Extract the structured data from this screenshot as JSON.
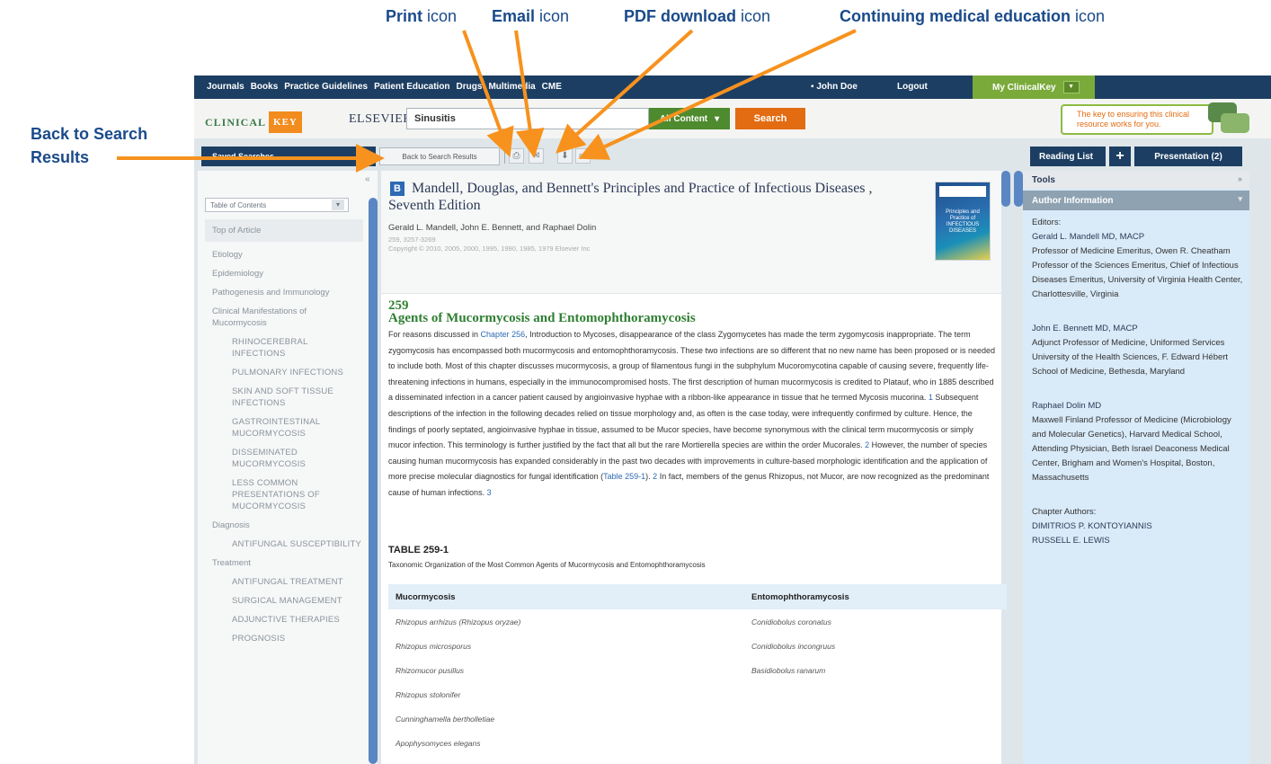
{
  "callouts": {
    "print": {
      "bold": "Print",
      "rest": " icon"
    },
    "email": {
      "bold": "Email",
      "rest": " icon"
    },
    "pdf": {
      "bold": "PDF download",
      "rest": " icon"
    },
    "cme": {
      "bold": "Continuing medical education",
      "rest": " icon"
    },
    "back_line1": "Back to Search",
    "back_line2": "Results"
  },
  "colors": {
    "callout_arrow": "#f7921e",
    "nav_bar": "#1c3e62",
    "accent_green": "#2f7f32"
  },
  "topnav": {
    "links": [
      "Journals",
      "Books",
      "Practice Guidelines",
      "Patient Education",
      "Drugs",
      "Multimedia",
      "CME"
    ],
    "user": "John Doe",
    "logout": "Logout",
    "my_clinicalkey": "My ClinicalKey"
  },
  "header": {
    "logo_left": "CLINICAL",
    "logo_key": "KEY",
    "elsevier": "ELSEVIER",
    "search_value": "Sinusitis",
    "content_dropdown": "All Content",
    "search_button": "Search",
    "tagline": "The key to ensuring this clinical resource works for you."
  },
  "toolbar": {
    "saved_searches": "Saved Searches",
    "back_to_results": "Back to Search Results",
    "icons": [
      "print-icon",
      "email-icon",
      "pdf-download-icon",
      "cme-icon"
    ],
    "reading_list": "Reading List",
    "presentation": "Presentation (2)"
  },
  "toc": {
    "collapse": "«",
    "select": "Table of Contents",
    "items": [
      {
        "label": "Top of Article",
        "level": 0
      },
      {
        "label": "Etiology",
        "level": 0
      },
      {
        "label": "Epidemiology",
        "level": 0
      },
      {
        "label": "Pathogenesis and Immunology",
        "level": 0
      },
      {
        "label": "Clinical Manifestations of Mucormycosis",
        "level": 0
      },
      {
        "label": "Rhinocerebral Infections",
        "level": 1
      },
      {
        "label": "Pulmonary Infections",
        "level": 1
      },
      {
        "label": "Skin and Soft Tissue Infections",
        "level": 1
      },
      {
        "label": "Gastrointestinal Mucormycosis",
        "level": 1
      },
      {
        "label": "Disseminated Mucormycosis",
        "level": 1
      },
      {
        "label": "Less Common Presentations of Mucormycosis",
        "level": 1
      },
      {
        "label": "Diagnosis",
        "level": 0
      },
      {
        "label": "Antifungal Susceptibility",
        "level": 1
      },
      {
        "label": "Treatment",
        "level": 0
      },
      {
        "label": "Antifungal Treatment",
        "level": 1
      },
      {
        "label": "Surgical Management",
        "level": 1
      },
      {
        "label": "Adjunctive Therapies",
        "level": 1
      },
      {
        "label": "Prognosis",
        "level": 1
      }
    ]
  },
  "article": {
    "book_badge": "B",
    "book_title": "Mandell, Douglas, and Bennett's Principles and Practice of Infectious Diseases ,",
    "edition": "Seventh Edition",
    "authors": "Gerald L. Mandell, John E. Bennett, and Raphael Dolin",
    "pages": "259, 3257-3269",
    "copyright": "Copyright © 2010, 2005, 2000, 1995, 1990, 1985, 1979 Elsevier Inc",
    "cover_text": "Principles and Practice of INFECTIOUS DISEASES",
    "chapter_number": "259",
    "chapter_title": "Agents of Mucormycosis and Entomophthoramycosis",
    "body": {
      "p1": "For reasons discussed in ",
      "link1": "Chapter 256",
      "p2": ", Introduction to Mycoses, disappearance of the class Zygomycetes has made the term zygomycosis inappropriate. The term zygomycosis has encompassed both mucormycosis and entomophthoramycosis. These two infections are so different that no new name has been proposed or is needed to include both. Most of this chapter discusses mucormycosis, a group of filamentous fungi in the subphylum Mucoromycotina capable of causing severe, frequently life-threatening infections in humans, especially in the immunocompromised hosts. The first description of human mucormycosis is credited to Platauf, who in 1885 described a disseminated infection in a cancer patient caused by angioinvasive hyphae with a ribbon-like appearance in tissue that he termed Mycosis mucorina.",
      "ref1": "1",
      "p3": " Subsequent descriptions of the infection in the following decades relied on tissue morphology and, as often is the case today, were infrequently confirmed by culture. Hence, the findings of poorly septated, angioinvasive hyphae in tissue, assumed to be Mucor species, have become synonymous with the clinical term mucormycosis or simply mucor infection. This terminology is further justified by the fact that all but the rare Mortierella species are within the order Mucorales.",
      "ref2": "2",
      "p4": " However, the number of species causing human mucormycosis has expanded considerably in the past two decades with improvements in culture-based morphologic identification and the application of more precise molecular diagnostics for fungal identification (",
      "link2": "Table 259-1",
      "p5": "). ",
      "ref3": "2",
      "p6": " In fact, members of the genus Rhizopus, not Mucor, are now recognized as the predominant cause of human infections.",
      "ref4": "3"
    },
    "table_label": "TABLE 259-1",
    "table_caption": "Taxonomic Organization of the Most Common Agents of Mucormycosis and Entomophthoramycosis",
    "table_headers": [
      "Mucormycosis",
      "Entomophthoramycosis"
    ],
    "table_rows": [
      [
        "Rhizopus arrhizus (Rhizopus oryzae)",
        "Conidiobolus coronatus"
      ],
      [
        "Rhizopus microsporus",
        "Conidiobolus incongruus"
      ],
      [
        "Rhizomucor pusillus",
        "Basidiobolus ranarum"
      ],
      [
        "Rhizopus stolonifer",
        ""
      ],
      [
        "Cunninghamella bertholletiae",
        ""
      ],
      [
        "Apophysomyces elegans",
        ""
      ]
    ]
  },
  "right": {
    "tools": "Tools",
    "tools_collapse": "»",
    "author_info": "Author Information",
    "editors_label": "Editors:",
    "editor1_name": "Gerald L. Mandell MD, MACP",
    "editor1_desc": "Professor of Medicine Emeritus, Owen R. Cheatham Professor of the Sciences Emeritus, Chief of Infectious Diseases Emeritus, University of Virginia Health Center, Charlottesville, Virginia",
    "editor2_name": "John E. Bennett MD, MACP",
    "editor2_desc": "Adjunct Professor of Medicine, Uniformed Services University of the Health Sciences, F. Edward Hébert School of Medicine, Bethesda, Maryland",
    "editor3_name": "Raphael Dolin MD",
    "editor3_desc": "Maxwell Finland Professor of Medicine (Microbiology and Molecular Genetics), Harvard Medical School, Attending Physician, Beth Israel Deaconess Medical Center, Brigham and Women's Hospital, Boston, Massachusetts",
    "chapter_authors_label": "Chapter Authors:",
    "chapter_author1": "Dimitrios P. Kontoyiannis",
    "chapter_author2": "Russell E. Lewis"
  }
}
